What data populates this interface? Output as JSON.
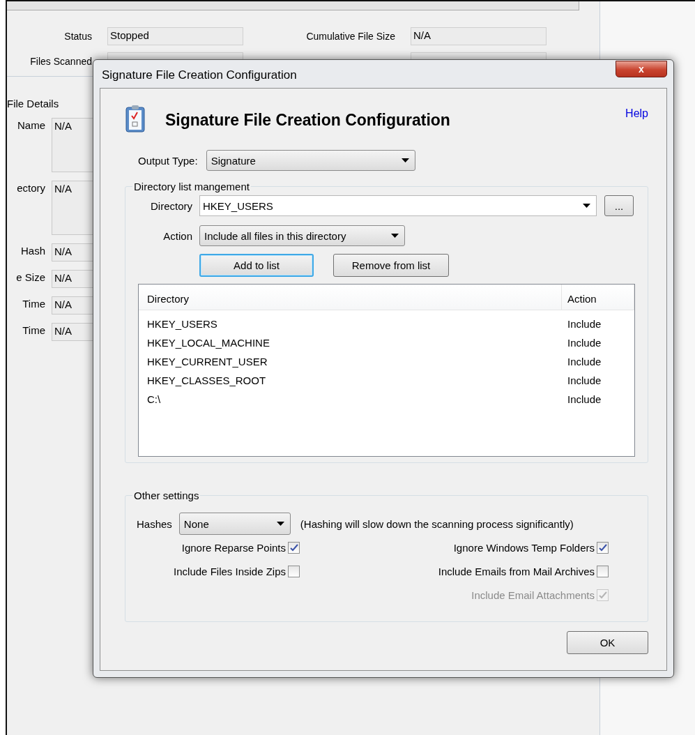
{
  "background_window": {
    "status_rows": [
      [
        {
          "label": "Status",
          "value": "Stopped"
        },
        {
          "label": "Cumulative File Size",
          "value": "N/A"
        }
      ],
      [
        {
          "label": "Files Scanned"
        },
        {}
      ]
    ],
    "file_details": {
      "title": "File Details",
      "fields": [
        {
          "label": "Name",
          "value": "N/A",
          "kind": "multiline"
        },
        {
          "label": "ectory",
          "value": "N/A",
          "kind": "multiline"
        },
        {
          "label": "Hash",
          "value": "N/A",
          "kind": "single"
        },
        {
          "label": "e Size",
          "value": "N/A",
          "kind": "single"
        },
        {
          "label": "Time",
          "value": "N/A",
          "kind": "single"
        },
        {
          "label": "Time",
          "value": "N/A",
          "kind": "single"
        }
      ]
    }
  },
  "dialog": {
    "title": "Signature File Creation Configuration",
    "close_button": "x",
    "heading": "Signature File Creation Configuration",
    "help_link": "Help",
    "output_type": {
      "label": "Output Type:",
      "value": "Signature"
    },
    "directory_group": {
      "title": "Directory list mangement",
      "directory": {
        "label": "Directory",
        "value": "HKEY_USERS"
      },
      "browse_button": "...",
      "action": {
        "label": "Action",
        "value": "Include all files in this directory"
      },
      "buttons": [
        {
          "label": "Add to list",
          "focused": true
        },
        {
          "label": "Remove from list",
          "focused": false
        }
      ],
      "list": {
        "columns": [
          "Directory",
          "Action"
        ],
        "rows": [
          {
            "directory": "HKEY_USERS",
            "action": "Include"
          },
          {
            "directory": "HKEY_LOCAL_MACHINE",
            "action": "Include"
          },
          {
            "directory": "HKEY_CURRENT_USER",
            "action": "Include"
          },
          {
            "directory": "HKEY_CLASSES_ROOT",
            "action": "Include"
          },
          {
            "directory": "C:\\",
            "action": "Include"
          }
        ]
      }
    },
    "other_group": {
      "title": "Other settings",
      "hashes": {
        "label": "Hashes",
        "value": "None"
      },
      "note": "(Hashing will slow down the scanning process significantly)",
      "checkbox_rows": [
        {
          "left": {
            "label": "Ignore Reparse Points",
            "checked": true,
            "disabled": false
          },
          "right": {
            "label": "Ignore Windows Temp Folders",
            "checked": true,
            "disabled": false
          }
        },
        {
          "left": {
            "label": "Include Files Inside Zips",
            "checked": false,
            "disabled": false
          },
          "right": {
            "label": "Include Emails from Mail Archives",
            "checked": false,
            "disabled": false
          }
        },
        {
          "right": {
            "label": "Include Email Attachments",
            "checked": true,
            "disabled": true
          }
        }
      ]
    },
    "ok_button": "OK"
  }
}
